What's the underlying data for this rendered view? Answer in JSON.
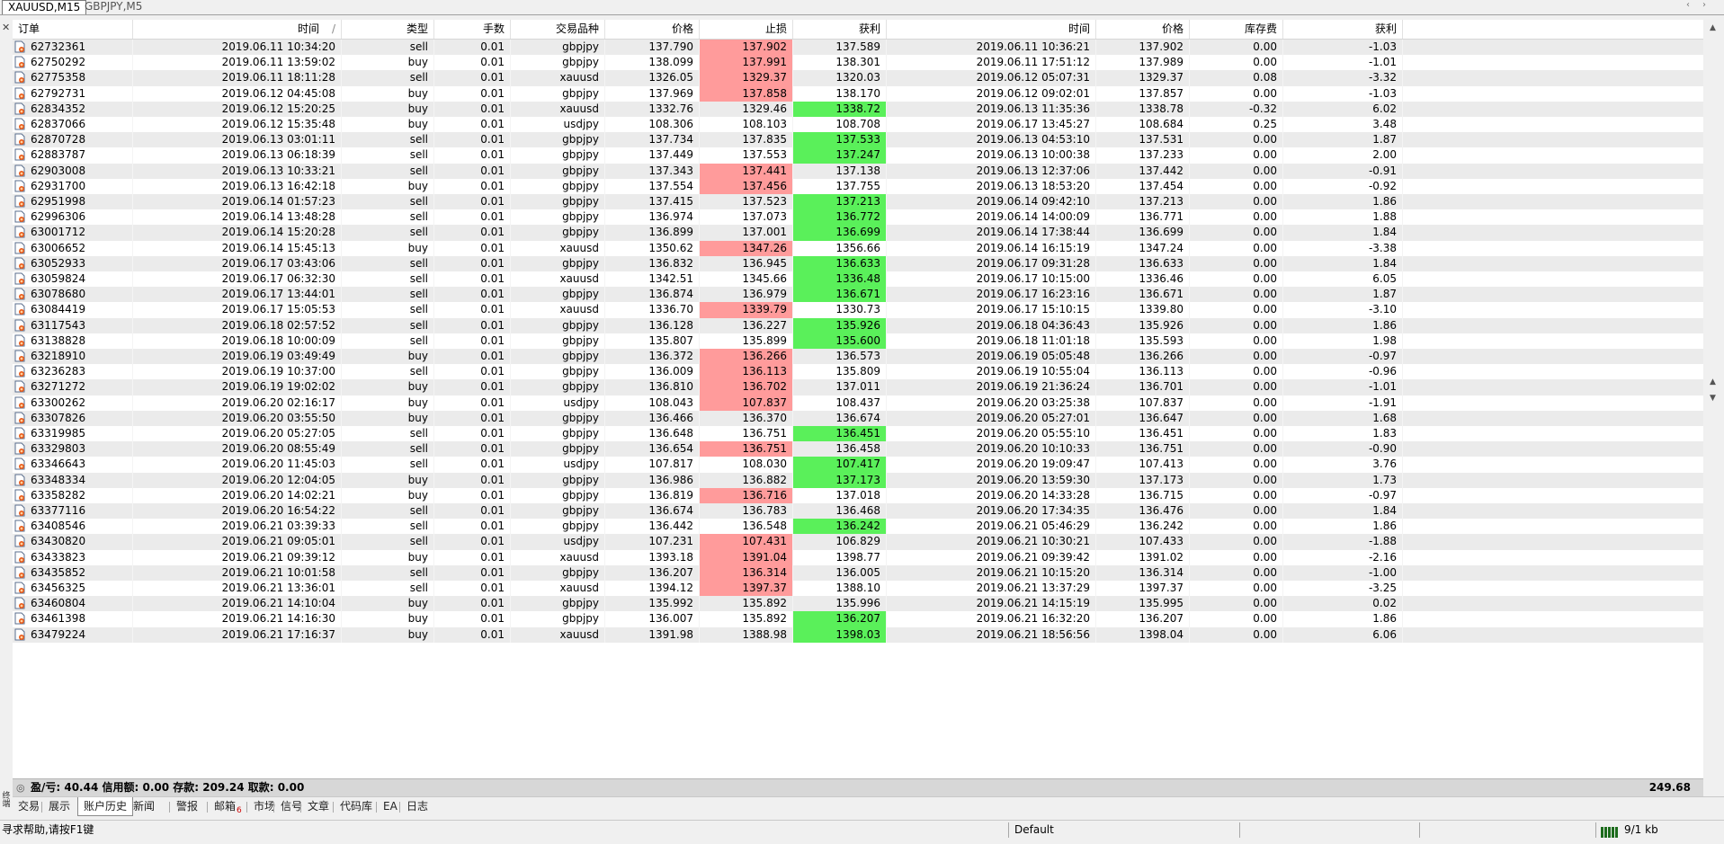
{
  "chart_tabs": [
    {
      "label": "XAUUSD,M15",
      "active": true
    },
    {
      "label": "GBPJPY,M5",
      "active": false
    }
  ],
  "columns": [
    "订单",
    "时间",
    "类型",
    "手数",
    "交易品种",
    "价格",
    "止损",
    "获利",
    "时间",
    "价格",
    "库存费",
    "获利"
  ],
  "sort_indicator": "/",
  "rows": [
    {
      "order": "62732361",
      "open_time": "2019.06.11 10:34:20",
      "type": "sell",
      "lots": "0.01",
      "symbol": "gbpjpy",
      "open_price": "137.790",
      "sl": "137.902",
      "tp": "137.589",
      "close_time": "2019.06.11 10:36:21",
      "close_price": "137.902",
      "swap": "0.00",
      "profit": "-1.03",
      "hit": "sl"
    },
    {
      "order": "62750292",
      "open_time": "2019.06.11 13:59:02",
      "type": "buy",
      "lots": "0.01",
      "symbol": "gbpjpy",
      "open_price": "138.099",
      "sl": "137.991",
      "tp": "138.301",
      "close_time": "2019.06.11 17:51:12",
      "close_price": "137.989",
      "swap": "0.00",
      "profit": "-1.01",
      "hit": "sl"
    },
    {
      "order": "62775358",
      "open_time": "2019.06.11 18:11:28",
      "type": "sell",
      "lots": "0.01",
      "symbol": "xauusd",
      "open_price": "1326.05",
      "sl": "1329.37",
      "tp": "1320.03",
      "close_time": "2019.06.12 05:07:31",
      "close_price": "1329.37",
      "swap": "0.08",
      "profit": "-3.32",
      "hit": "sl"
    },
    {
      "order": "62792731",
      "open_time": "2019.06.12 04:45:08",
      "type": "buy",
      "lots": "0.01",
      "symbol": "gbpjpy",
      "open_price": "137.969",
      "sl": "137.858",
      "tp": "138.170",
      "close_time": "2019.06.12 09:02:01",
      "close_price": "137.857",
      "swap": "0.00",
      "profit": "-1.03",
      "hit": "sl"
    },
    {
      "order": "62834352",
      "open_time": "2019.06.12 15:20:25",
      "type": "buy",
      "lots": "0.01",
      "symbol": "xauusd",
      "open_price": "1332.76",
      "sl": "1329.46",
      "tp": "1338.72",
      "close_time": "2019.06.13 11:35:36",
      "close_price": "1338.78",
      "swap": "-0.32",
      "profit": "6.02",
      "hit": "tp"
    },
    {
      "order": "62837066",
      "open_time": "2019.06.12 15:35:48",
      "type": "buy",
      "lots": "0.01",
      "symbol": "usdjpy",
      "open_price": "108.306",
      "sl": "108.103",
      "tp": "108.708",
      "close_time": "2019.06.17 13:45:27",
      "close_price": "108.684",
      "swap": "0.25",
      "profit": "3.48",
      "hit": ""
    },
    {
      "order": "62870728",
      "open_time": "2019.06.13 03:01:11",
      "type": "sell",
      "lots": "0.01",
      "symbol": "gbpjpy",
      "open_price": "137.734",
      "sl": "137.835",
      "tp": "137.533",
      "close_time": "2019.06.13 04:53:10",
      "close_price": "137.531",
      "swap": "0.00",
      "profit": "1.87",
      "hit": "tp"
    },
    {
      "order": "62883787",
      "open_time": "2019.06.13 06:18:39",
      "type": "sell",
      "lots": "0.01",
      "symbol": "gbpjpy",
      "open_price": "137.449",
      "sl": "137.553",
      "tp": "137.247",
      "close_time": "2019.06.13 10:00:38",
      "close_price": "137.233",
      "swap": "0.00",
      "profit": "2.00",
      "hit": "tp"
    },
    {
      "order": "62903008",
      "open_time": "2019.06.13 10:33:21",
      "type": "sell",
      "lots": "0.01",
      "symbol": "gbpjpy",
      "open_price": "137.343",
      "sl": "137.441",
      "tp": "137.138",
      "close_time": "2019.06.13 12:37:06",
      "close_price": "137.442",
      "swap": "0.00",
      "profit": "-0.91",
      "hit": "sl"
    },
    {
      "order": "62931700",
      "open_time": "2019.06.13 16:42:18",
      "type": "buy",
      "lots": "0.01",
      "symbol": "gbpjpy",
      "open_price": "137.554",
      "sl": "137.456",
      "tp": "137.755",
      "close_time": "2019.06.13 18:53:20",
      "close_price": "137.454",
      "swap": "0.00",
      "profit": "-0.92",
      "hit": "sl"
    },
    {
      "order": "62951998",
      "open_time": "2019.06.14 01:57:23",
      "type": "sell",
      "lots": "0.01",
      "symbol": "gbpjpy",
      "open_price": "137.415",
      "sl": "137.523",
      "tp": "137.213",
      "close_time": "2019.06.14 09:42:10",
      "close_price": "137.213",
      "swap": "0.00",
      "profit": "1.86",
      "hit": "tp"
    },
    {
      "order": "62996306",
      "open_time": "2019.06.14 13:48:28",
      "type": "sell",
      "lots": "0.01",
      "symbol": "gbpjpy",
      "open_price": "136.974",
      "sl": "137.073",
      "tp": "136.772",
      "close_time": "2019.06.14 14:00:09",
      "close_price": "136.771",
      "swap": "0.00",
      "profit": "1.88",
      "hit": "tp"
    },
    {
      "order": "63001712",
      "open_time": "2019.06.14 15:20:28",
      "type": "sell",
      "lots": "0.01",
      "symbol": "gbpjpy",
      "open_price": "136.899",
      "sl": "137.001",
      "tp": "136.699",
      "close_time": "2019.06.14 17:38:44",
      "close_price": "136.699",
      "swap": "0.00",
      "profit": "1.84",
      "hit": "tp"
    },
    {
      "order": "63006652",
      "open_time": "2019.06.14 15:45:13",
      "type": "buy",
      "lots": "0.01",
      "symbol": "xauusd",
      "open_price": "1350.62",
      "sl": "1347.26",
      "tp": "1356.66",
      "close_time": "2019.06.14 16:15:19",
      "close_price": "1347.24",
      "swap": "0.00",
      "profit": "-3.38",
      "hit": "sl"
    },
    {
      "order": "63052933",
      "open_time": "2019.06.17 03:43:06",
      "type": "sell",
      "lots": "0.01",
      "symbol": "gbpjpy",
      "open_price": "136.832",
      "sl": "136.945",
      "tp": "136.633",
      "close_time": "2019.06.17 09:31:28",
      "close_price": "136.633",
      "swap": "0.00",
      "profit": "1.84",
      "hit": "tp"
    },
    {
      "order": "63059824",
      "open_time": "2019.06.17 06:32:30",
      "type": "sell",
      "lots": "0.01",
      "symbol": "xauusd",
      "open_price": "1342.51",
      "sl": "1345.66",
      "tp": "1336.48",
      "close_time": "2019.06.17 10:15:00",
      "close_price": "1336.46",
      "swap": "0.00",
      "profit": "6.05",
      "hit": "tp"
    },
    {
      "order": "63078680",
      "open_time": "2019.06.17 13:44:01",
      "type": "sell",
      "lots": "0.01",
      "symbol": "gbpjpy",
      "open_price": "136.874",
      "sl": "136.979",
      "tp": "136.671",
      "close_time": "2019.06.17 16:23:16",
      "close_price": "136.671",
      "swap": "0.00",
      "profit": "1.87",
      "hit": "tp"
    },
    {
      "order": "63084419",
      "open_time": "2019.06.17 15:05:53",
      "type": "sell",
      "lots": "0.01",
      "symbol": "xauusd",
      "open_price": "1336.70",
      "sl": "1339.79",
      "tp": "1330.73",
      "close_time": "2019.06.17 15:10:15",
      "close_price": "1339.80",
      "swap": "0.00",
      "profit": "-3.10",
      "hit": "sl"
    },
    {
      "order": "63117543",
      "open_time": "2019.06.18 02:57:52",
      "type": "sell",
      "lots": "0.01",
      "symbol": "gbpjpy",
      "open_price": "136.128",
      "sl": "136.227",
      "tp": "135.926",
      "close_time": "2019.06.18 04:36:43",
      "close_price": "135.926",
      "swap": "0.00",
      "profit": "1.86",
      "hit": "tp"
    },
    {
      "order": "63138828",
      "open_time": "2019.06.18 10:00:09",
      "type": "sell",
      "lots": "0.01",
      "symbol": "gbpjpy",
      "open_price": "135.807",
      "sl": "135.899",
      "tp": "135.600",
      "close_time": "2019.06.18 11:01:18",
      "close_price": "135.593",
      "swap": "0.00",
      "profit": "1.98",
      "hit": "tp"
    },
    {
      "order": "63218910",
      "open_time": "2019.06.19 03:49:49",
      "type": "buy",
      "lots": "0.01",
      "symbol": "gbpjpy",
      "open_price": "136.372",
      "sl": "136.266",
      "tp": "136.573",
      "close_time": "2019.06.19 05:05:48",
      "close_price": "136.266",
      "swap": "0.00",
      "profit": "-0.97",
      "hit": "sl"
    },
    {
      "order": "63236283",
      "open_time": "2019.06.19 10:37:00",
      "type": "sell",
      "lots": "0.01",
      "symbol": "gbpjpy",
      "open_price": "136.009",
      "sl": "136.113",
      "tp": "135.809",
      "close_time": "2019.06.19 10:55:04",
      "close_price": "136.113",
      "swap": "0.00",
      "profit": "-0.96",
      "hit": "sl"
    },
    {
      "order": "63271272",
      "open_time": "2019.06.19 19:02:02",
      "type": "buy",
      "lots": "0.01",
      "symbol": "gbpjpy",
      "open_price": "136.810",
      "sl": "136.702",
      "tp": "137.011",
      "close_time": "2019.06.19 21:36:24",
      "close_price": "136.701",
      "swap": "0.00",
      "profit": "-1.01",
      "hit": "sl"
    },
    {
      "order": "63300262",
      "open_time": "2019.06.20 02:16:17",
      "type": "buy",
      "lots": "0.01",
      "symbol": "usdjpy",
      "open_price": "108.043",
      "sl": "107.837",
      "tp": "108.437",
      "close_time": "2019.06.20 03:25:38",
      "close_price": "107.837",
      "swap": "0.00",
      "profit": "-1.91",
      "hit": "sl"
    },
    {
      "order": "63307826",
      "open_time": "2019.06.20 03:55:50",
      "type": "buy",
      "lots": "0.01",
      "symbol": "gbpjpy",
      "open_price": "136.466",
      "sl": "136.370",
      "tp": "136.674",
      "close_time": "2019.06.20 05:27:01",
      "close_price": "136.647",
      "swap": "0.00",
      "profit": "1.68",
      "hit": ""
    },
    {
      "order": "63319985",
      "open_time": "2019.06.20 05:27:05",
      "type": "sell",
      "lots": "0.01",
      "symbol": "gbpjpy",
      "open_price": "136.648",
      "sl": "136.751",
      "tp": "136.451",
      "close_time": "2019.06.20 05:55:10",
      "close_price": "136.451",
      "swap": "0.00",
      "profit": "1.83",
      "hit": "tp"
    },
    {
      "order": "63329803",
      "open_time": "2019.06.20 08:55:49",
      "type": "sell",
      "lots": "0.01",
      "symbol": "gbpjpy",
      "open_price": "136.654",
      "sl": "136.751",
      "tp": "136.458",
      "close_time": "2019.06.20 10:10:33",
      "close_price": "136.751",
      "swap": "0.00",
      "profit": "-0.90",
      "hit": "sl"
    },
    {
      "order": "63346643",
      "open_time": "2019.06.20 11:45:03",
      "type": "sell",
      "lots": "0.01",
      "symbol": "usdjpy",
      "open_price": "107.817",
      "sl": "108.030",
      "tp": "107.417",
      "close_time": "2019.06.20 19:09:47",
      "close_price": "107.413",
      "swap": "0.00",
      "profit": "3.76",
      "hit": "tp"
    },
    {
      "order": "63348334",
      "open_time": "2019.06.20 12:04:05",
      "type": "buy",
      "lots": "0.01",
      "symbol": "gbpjpy",
      "open_price": "136.986",
      "sl": "136.882",
      "tp": "137.173",
      "close_time": "2019.06.20 13:59:30",
      "close_price": "137.173",
      "swap": "0.00",
      "profit": "1.73",
      "hit": "tp"
    },
    {
      "order": "63358282",
      "open_time": "2019.06.20 14:02:21",
      "type": "buy",
      "lots": "0.01",
      "symbol": "gbpjpy",
      "open_price": "136.819",
      "sl": "136.716",
      "tp": "137.018",
      "close_time": "2019.06.20 14:33:28",
      "close_price": "136.715",
      "swap": "0.00",
      "profit": "-0.97",
      "hit": "sl"
    },
    {
      "order": "63377116",
      "open_time": "2019.06.20 16:54:22",
      "type": "sell",
      "lots": "0.01",
      "symbol": "gbpjpy",
      "open_price": "136.674",
      "sl": "136.783",
      "tp": "136.468",
      "close_time": "2019.06.20 17:34:35",
      "close_price": "136.476",
      "swap": "0.00",
      "profit": "1.84",
      "hit": ""
    },
    {
      "order": "63408546",
      "open_time": "2019.06.21 03:39:33",
      "type": "sell",
      "lots": "0.01",
      "symbol": "gbpjpy",
      "open_price": "136.442",
      "sl": "136.548",
      "tp": "136.242",
      "close_time": "2019.06.21 05:46:29",
      "close_price": "136.242",
      "swap": "0.00",
      "profit": "1.86",
      "hit": "tp"
    },
    {
      "order": "63430820",
      "open_time": "2019.06.21 09:05:01",
      "type": "sell",
      "lots": "0.01",
      "symbol": "usdjpy",
      "open_price": "107.231",
      "sl": "107.431",
      "tp": "106.829",
      "close_time": "2019.06.21 10:30:21",
      "close_price": "107.433",
      "swap": "0.00",
      "profit": "-1.88",
      "hit": "sl"
    },
    {
      "order": "63433823",
      "open_time": "2019.06.21 09:39:12",
      "type": "buy",
      "lots": "0.01",
      "symbol": "xauusd",
      "open_price": "1393.18",
      "sl": "1391.04",
      "tp": "1398.77",
      "close_time": "2019.06.21 09:39:42",
      "close_price": "1391.02",
      "swap": "0.00",
      "profit": "-2.16",
      "hit": "sl"
    },
    {
      "order": "63435852",
      "open_time": "2019.06.21 10:01:58",
      "type": "sell",
      "lots": "0.01",
      "symbol": "gbpjpy",
      "open_price": "136.207",
      "sl": "136.314",
      "tp": "136.005",
      "close_time": "2019.06.21 10:15:20",
      "close_price": "136.314",
      "swap": "0.00",
      "profit": "-1.00",
      "hit": "sl"
    },
    {
      "order": "63456325",
      "open_time": "2019.06.21 13:36:01",
      "type": "sell",
      "lots": "0.01",
      "symbol": "xauusd",
      "open_price": "1394.12",
      "sl": "1397.37",
      "tp": "1388.10",
      "close_time": "2019.06.21 13:37:29",
      "close_price": "1397.37",
      "swap": "0.00",
      "profit": "-3.25",
      "hit": "sl"
    },
    {
      "order": "63460804",
      "open_time": "2019.06.21 14:10:04",
      "type": "buy",
      "lots": "0.01",
      "symbol": "gbpjpy",
      "open_price": "135.992",
      "sl": "135.892",
      "tp": "135.996",
      "close_time": "2019.06.21 14:15:19",
      "close_price": "135.995",
      "swap": "0.00",
      "profit": "0.02",
      "hit": ""
    },
    {
      "order": "63461398",
      "open_time": "2019.06.21 14:16:30",
      "type": "buy",
      "lots": "0.01",
      "symbol": "gbpjpy",
      "open_price": "136.007",
      "sl": "135.892",
      "tp": "136.207",
      "close_time": "2019.06.21 16:32:20",
      "close_price": "136.207",
      "swap": "0.00",
      "profit": "1.86",
      "hit": "tp"
    },
    {
      "order": "63479224",
      "open_time": "2019.06.21 17:16:37",
      "type": "buy",
      "lots": "0.01",
      "symbol": "xauusd",
      "open_price": "1391.98",
      "sl": "1388.98",
      "tp": "1398.03",
      "close_time": "2019.06.21 18:56:56",
      "close_price": "1398.04",
      "swap": "0.00",
      "profit": "6.06",
      "hit": "tp"
    }
  ],
  "summary": {
    "text": "盈/亏: 40.44  信用额: 0.00  存款: 209.24  取款: 0.00",
    "total": "249.68"
  },
  "side_label": "终端",
  "bottom_tabs": [
    {
      "label": "交易",
      "active": false,
      "badge": ""
    },
    {
      "label": "展示",
      "active": false,
      "badge": ""
    },
    {
      "label": "账户历史",
      "active": true,
      "badge": ""
    },
    {
      "label": "新闻",
      "active": false,
      "badge": ""
    },
    {
      "label": "警报",
      "active": false,
      "badge": ""
    },
    {
      "label": "邮箱",
      "active": false,
      "badge": "6"
    },
    {
      "label": "市场",
      "active": false,
      "badge": ""
    },
    {
      "label": "信号",
      "active": false,
      "badge": ""
    },
    {
      "label": "文章",
      "active": false,
      "badge": ""
    },
    {
      "label": "代码库",
      "active": false,
      "badge": ""
    },
    {
      "label": "EA",
      "active": false,
      "badge": ""
    },
    {
      "label": "日志",
      "active": false,
      "badge": ""
    }
  ],
  "statusbar": {
    "help": "寻求帮助,请按F1键",
    "profile": "Default",
    "traffic": "9/1 kb"
  },
  "colors": {
    "sl_hit": "#ff9b9b",
    "tp_hit": "#5af05a",
    "alt_row": "#ebebeb"
  },
  "icons": {
    "order": "order-document-icon",
    "close": "close-icon",
    "traffic": "connection-bars-icon"
  }
}
